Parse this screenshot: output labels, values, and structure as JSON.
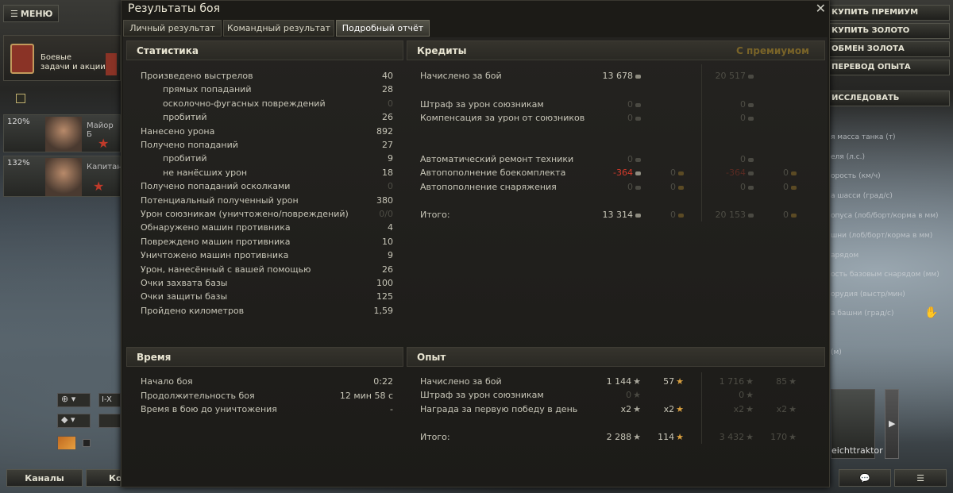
{
  "hangar": {
    "menu_label": "МЕНЮ",
    "missions_label_1": "Боевые",
    "missions_label_2": "задачи и акции",
    "crew": [
      {
        "pct": "120%",
        "name": "Майор Б"
      },
      {
        "pct": "132%",
        "name": "Капитан"
      }
    ],
    "tank_level": "I-X",
    "channels_label": "Каналы",
    "cont_label": "Кон",
    "right_buttons": [
      "КУПИТЬ ПРЕМИУМ",
      "КУПИТЬ ЗОЛОТО",
      "ОБМЕН ЗОЛОТА",
      "ПЕРЕВОД ОПЫТА",
      "ИССЛЕДОВАТЬ"
    ],
    "right_stats": [
      "я масса танка (т)",
      "еля (л.с.)",
      "орость (км/ч)",
      "а шасси (град/с)",
      "опуса (лоб/борт/корма в мм)",
      "шни (лоб/борт/корма в мм)",
      "арядом",
      "ость базовым снарядом (мм)",
      "орудия (выстр/мин)",
      "а башни (град/с)",
      "(м)"
    ],
    "tank_name": "eichttraktor"
  },
  "window": {
    "title": "Результаты боя",
    "tabs": [
      "Личный результат",
      "Командный результат",
      "Подробный отчёт"
    ],
    "active_tab": "Подробный отчёт"
  },
  "stats": {
    "header": "Статистика",
    "rows": [
      {
        "label": "Произведено выстрелов",
        "value": "40",
        "indent": false
      },
      {
        "label": "прямых попаданий",
        "value": "28",
        "indent": true
      },
      {
        "label": "осколочно-фугасных повреждений",
        "value": "0",
        "indent": true,
        "dim": true
      },
      {
        "label": "пробитий",
        "value": "26",
        "indent": true
      },
      {
        "label": "Нанесено урона",
        "value": "892",
        "indent": false
      },
      {
        "label": "Получено попаданий",
        "value": "27",
        "indent": false
      },
      {
        "label": "пробитий",
        "value": "9",
        "indent": true
      },
      {
        "label": "не нанёсших урон",
        "value": "18",
        "indent": true
      },
      {
        "label": "Получено попаданий осколками",
        "value": "0",
        "indent": false,
        "dim": true
      },
      {
        "label": "Потенциальный полученный урон",
        "value": "380",
        "indent": false
      },
      {
        "label": "Урон союзникам (уничтожено/повреждений)",
        "value": "0/0",
        "indent": false,
        "dim": true
      },
      {
        "label": "Обнаружено машин противника",
        "value": "4",
        "indent": false
      },
      {
        "label": "Повреждено машин противника",
        "value": "10",
        "indent": false
      },
      {
        "label": "Уничтожено машин противника",
        "value": "9",
        "indent": false
      },
      {
        "label": "Урон, нанесённый с вашей помощью",
        "value": "26",
        "indent": false
      },
      {
        "label": "Очки захвата базы",
        "value": "100",
        "indent": false
      },
      {
        "label": "Очки защиты базы",
        "value": "125",
        "indent": false
      },
      {
        "label": "Пройдено километров",
        "value": "1,59",
        "indent": false
      }
    ]
  },
  "credits": {
    "header": "Кредиты",
    "premium_header": "С премиумом",
    "rows": [
      {
        "label": "Начислено за бой",
        "c": "13 678",
        "g": "",
        "pc": "20 517",
        "pg": ""
      },
      {
        "label": "Штраф за урон союзникам",
        "c": "0",
        "g": "",
        "pc": "0",
        "pg": ""
      },
      {
        "label": "Компенсация за урон от союзников",
        "c": "0",
        "g": "",
        "pc": "0",
        "pg": ""
      },
      {
        "label": "Автоматический ремонт техники",
        "c": "0",
        "g": "",
        "pc": "0",
        "pg": ""
      },
      {
        "label": "Автопополнение боекомплекта",
        "c": "-364",
        "g": "0",
        "pc": "-364",
        "pg": "0"
      },
      {
        "label": "Автопополнение снаряжения",
        "c": "0",
        "g": "0",
        "pc": "0",
        "pg": "0"
      },
      {
        "label": "Итого:",
        "c": "13 314",
        "g": "0",
        "pc": "20 153",
        "pg": "0"
      }
    ]
  },
  "time": {
    "header": "Время",
    "rows": [
      {
        "label": "Начало боя",
        "value": "0:22"
      },
      {
        "label": "Продолжительность боя",
        "value": "12 мин 58 с"
      },
      {
        "label": "Время в бою до уничтожения",
        "value": "-"
      }
    ]
  },
  "exp": {
    "header": "Опыт",
    "rows": [
      {
        "label": "Начислено за бой",
        "xp": "1 144",
        "fxp": "57",
        "pxp": "1 716",
        "pfxp": "85"
      },
      {
        "label": "Штраф за урон союзникам",
        "xp": "0",
        "fxp": "",
        "pxp": "0",
        "pfxp": ""
      },
      {
        "label": "Награда за первую победу в день",
        "xp": "x2",
        "fxp": "x2",
        "pxp": "x2",
        "pfxp": "x2"
      },
      {
        "label": "Итого:",
        "xp": "2 288",
        "fxp": "114",
        "pxp": "3 432",
        "pfxp": "170"
      }
    ]
  },
  "colors": {
    "accent_gold": "#d9a040",
    "penalty_red": "#d63a2b",
    "premium_header": "#8a6a2a"
  }
}
